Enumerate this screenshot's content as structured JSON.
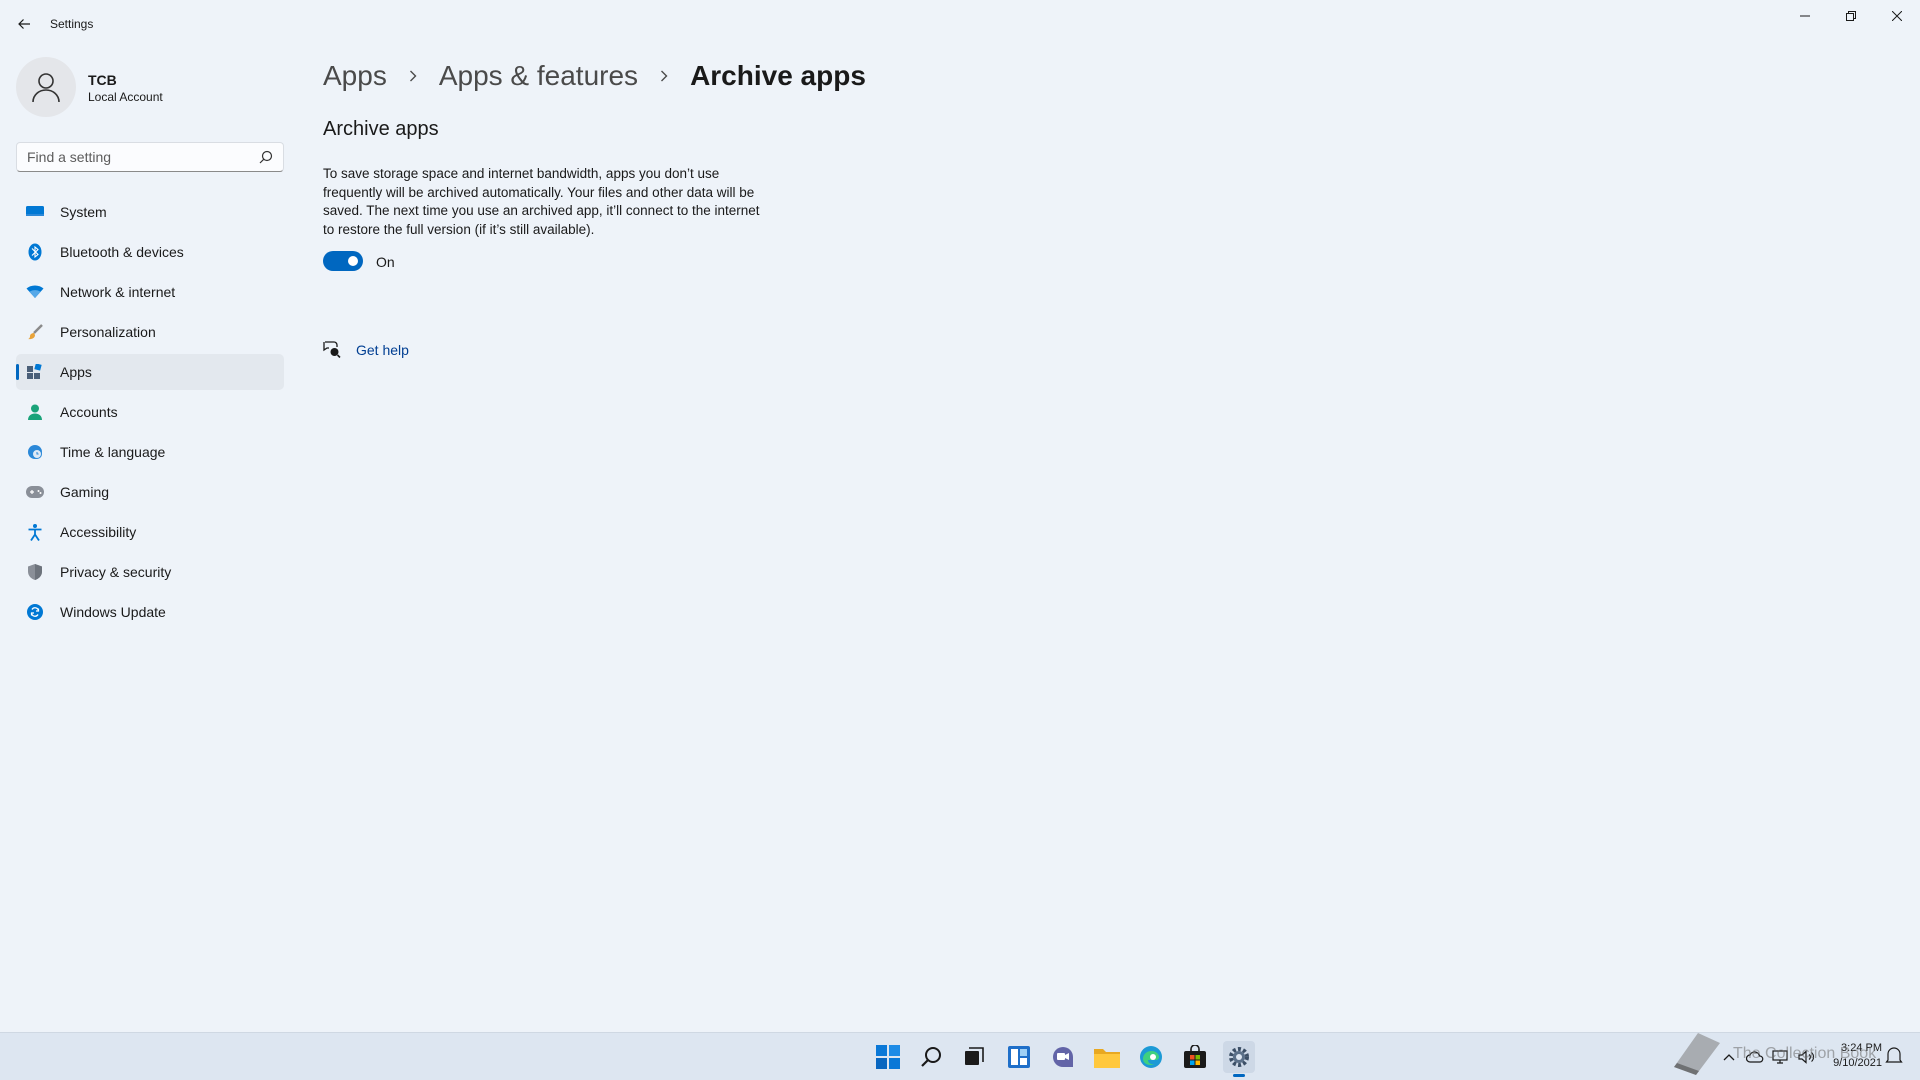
{
  "window": {
    "title": "Settings"
  },
  "profile": {
    "name": "TCB",
    "account_type": "Local Account"
  },
  "search": {
    "placeholder": "Find a setting"
  },
  "sidebar": {
    "items": [
      {
        "label": "System",
        "icon": "monitor-icon"
      },
      {
        "label": "Bluetooth & devices",
        "icon": "bluetooth-icon"
      },
      {
        "label": "Network & internet",
        "icon": "wifi-icon"
      },
      {
        "label": "Personalization",
        "icon": "brush-icon"
      },
      {
        "label": "Apps",
        "icon": "apps-icon",
        "active": true
      },
      {
        "label": "Accounts",
        "icon": "person-icon"
      },
      {
        "label": "Time & language",
        "icon": "globe-clock-icon"
      },
      {
        "label": "Gaming",
        "icon": "gamepad-icon"
      },
      {
        "label": "Accessibility",
        "icon": "accessibility-icon"
      },
      {
        "label": "Privacy & security",
        "icon": "shield-icon"
      },
      {
        "label": "Windows Update",
        "icon": "update-icon"
      }
    ]
  },
  "breadcrumb": {
    "items": [
      "Apps",
      "Apps & features"
    ],
    "current": "Archive apps"
  },
  "main": {
    "section_title": "Archive apps",
    "description": "To save storage space and internet bandwidth, apps you don’t use frequently will be archived automatically. Your files and other data will be saved. The next time you use an archived app, it’ll connect to the internet to restore the full version (if it’s still available).",
    "toggle_state": "On",
    "get_help": "Get help"
  },
  "taskbar": {
    "clock_time": "3:24 PM",
    "clock_date": "9/10/2021",
    "watermark": "The Collection Book"
  },
  "colors": {
    "accent": "#0067c0",
    "background": "#eef3f9",
    "taskbar": "#dde6f1"
  }
}
